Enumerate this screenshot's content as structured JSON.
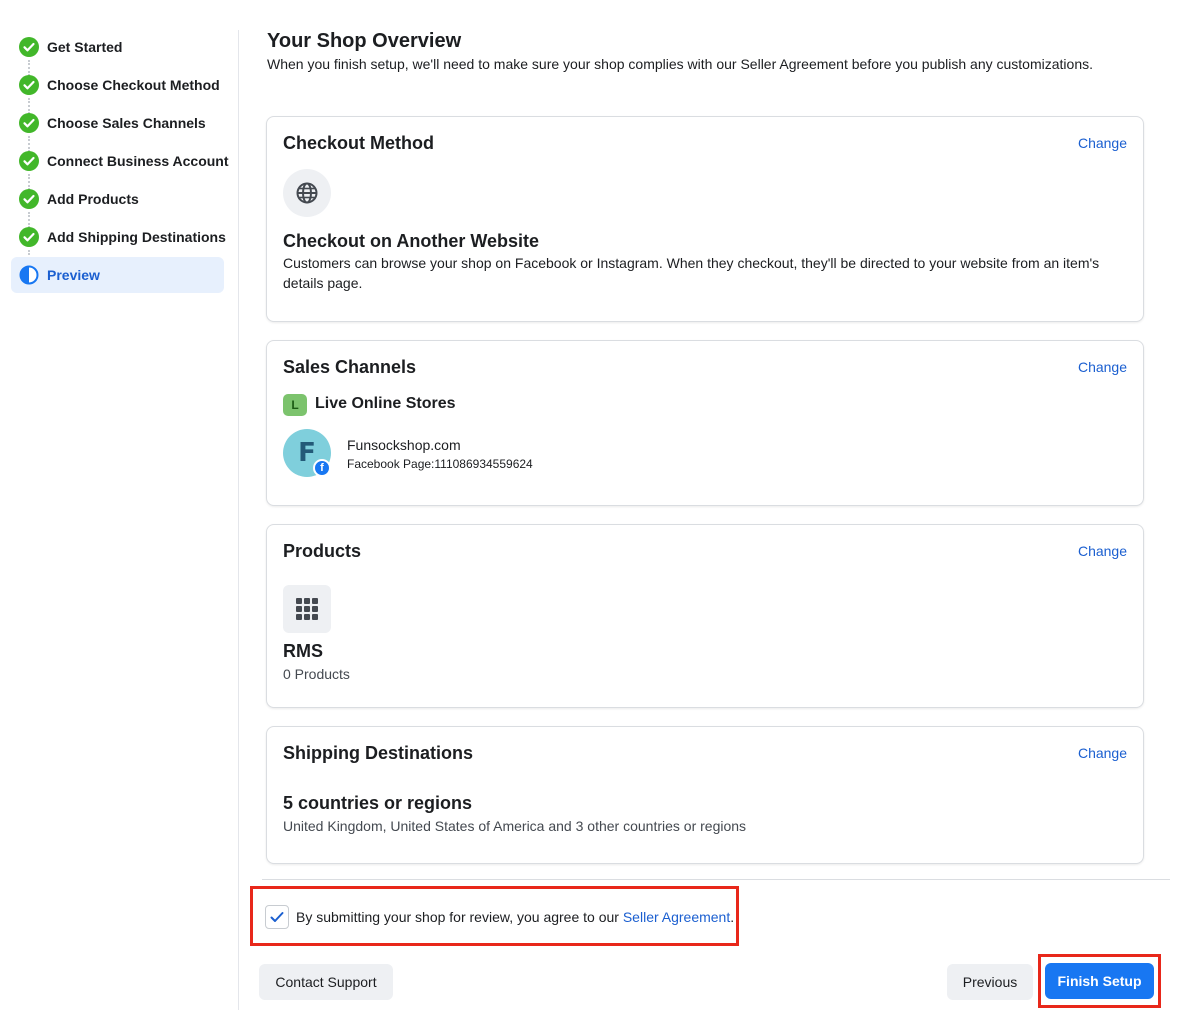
{
  "sidebar": {
    "steps": [
      {
        "label": "Get Started",
        "status": "complete"
      },
      {
        "label": "Choose Checkout Method",
        "status": "complete"
      },
      {
        "label": "Choose Sales Channels",
        "status": "complete"
      },
      {
        "label": "Connect Business Account",
        "status": "complete"
      },
      {
        "label": "Add Products",
        "status": "complete"
      },
      {
        "label": "Add Shipping Destinations",
        "status": "complete"
      },
      {
        "label": "Preview",
        "status": "active"
      }
    ]
  },
  "main": {
    "title": "Your Shop Overview",
    "subtitle": "When you finish setup, we'll need to make sure your shop complies with our Seller Agreement before you publish any customizations."
  },
  "checkout": {
    "title": "Checkout Method",
    "change": "Change",
    "icon": "globe-icon",
    "method": "Checkout on Another Website",
    "description_line1": "Customers can browse your shop on Facebook or Instagram. When they checkout, they'll be directed to your website from an item's",
    "description_line2": "details page."
  },
  "channels": {
    "title": "Sales Channels",
    "change": "Change",
    "badge": "L",
    "group_label": "Live Online Stores",
    "avatar_letter": "F",
    "store_name": "Funsockshop.com",
    "store_page": "Facebook Page:111086934559624"
  },
  "products": {
    "title": "Products",
    "change": "Change",
    "icon": "grid-icon",
    "catalog": "RMS",
    "count": "0 Products"
  },
  "shipping": {
    "title": "Shipping Destinations",
    "change": "Change",
    "summary": "5 countries or regions",
    "detail": "United Kingdom, United States of America and 3 other countries or regions"
  },
  "agreement": {
    "checked": true,
    "text": "By submitting your shop for review, you agree to our ",
    "link": "Seller Agreement",
    "suffix": "."
  },
  "footer": {
    "contact": "Contact Support",
    "previous": "Previous",
    "finish": "Finish Setup"
  },
  "colors": {
    "accent": "#1877f2",
    "link": "#1b5fd0",
    "success": "#42b72a",
    "highlight": "#e8271a"
  }
}
